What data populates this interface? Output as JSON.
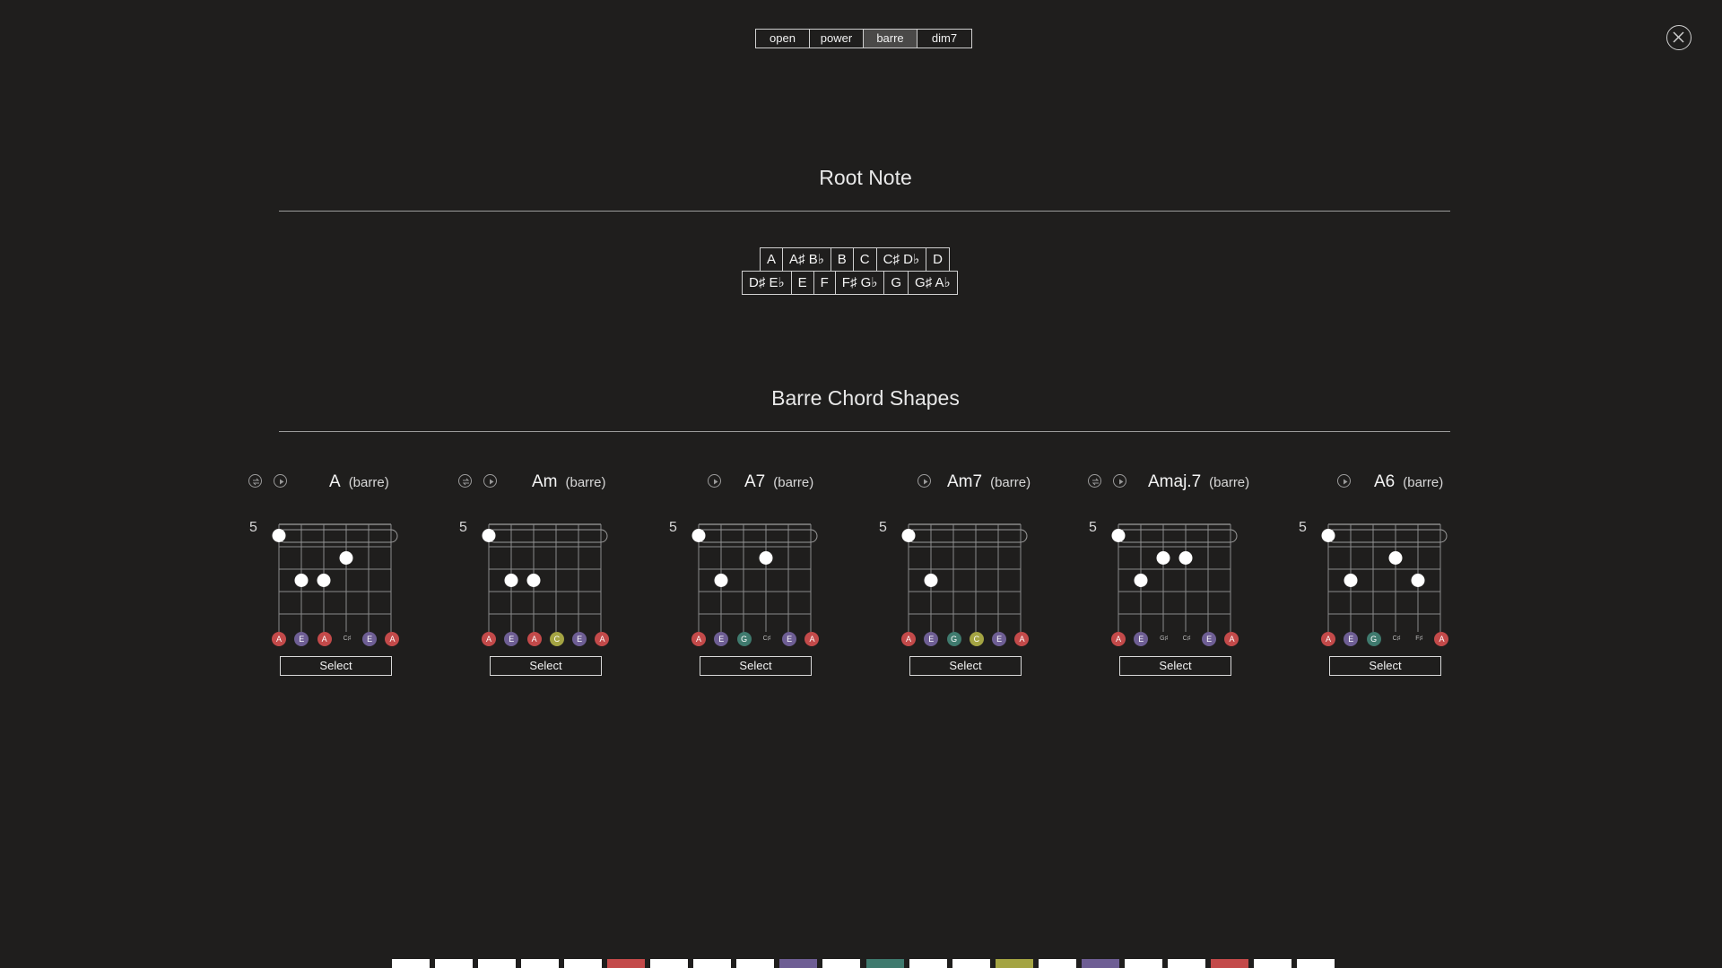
{
  "type_tabs": {
    "items": [
      "open",
      "power",
      "barre",
      "dim7"
    ],
    "selected": "barre"
  },
  "close_icon": "close-icon",
  "root_note": {
    "title": "Root Note",
    "row1": [
      "A",
      "A♯ B♭",
      "B",
      "C",
      "C♯ D♭",
      "D"
    ],
    "row2": [
      "D♯ E♭",
      "E",
      "F",
      "F♯ G♭",
      "G",
      "G♯ A♭"
    ]
  },
  "shapes": {
    "title": "Barre Chord Shapes",
    "select_label": "Select",
    "chords": [
      {
        "name": "A",
        "type": "(barre)",
        "fret": "5",
        "has_swap": true,
        "dots": [
          {
            "string": 1,
            "fret": 1
          },
          {
            "string": 2,
            "fret": 3
          },
          {
            "string": 3,
            "fret": 3
          },
          {
            "string": 4,
            "fret": 2
          }
        ],
        "notes": [
          {
            "label": "A",
            "color": "#c34a4a"
          },
          {
            "label": "E",
            "color": "#6e5e94"
          },
          {
            "label": "A",
            "color": "#c34a4a"
          },
          {
            "label": "C♯",
            "color": ""
          },
          {
            "label": "E",
            "color": "#6e5e94"
          },
          {
            "label": "A",
            "color": "#c34a4a"
          }
        ]
      },
      {
        "name": "Am",
        "type": "(barre)",
        "fret": "5",
        "has_swap": true,
        "dots": [
          {
            "string": 1,
            "fret": 1
          },
          {
            "string": 2,
            "fret": 3
          },
          {
            "string": 3,
            "fret": 3
          }
        ],
        "notes": [
          {
            "label": "A",
            "color": "#c34a4a"
          },
          {
            "label": "E",
            "color": "#6e5e94"
          },
          {
            "label": "A",
            "color": "#c34a4a"
          },
          {
            "label": "C",
            "color": "#a4a443"
          },
          {
            "label": "E",
            "color": "#6e5e94"
          },
          {
            "label": "A",
            "color": "#c34a4a"
          }
        ]
      },
      {
        "name": "A7",
        "type": "(barre)",
        "fret": "5",
        "has_swap": false,
        "dots": [
          {
            "string": 1,
            "fret": 1
          },
          {
            "string": 2,
            "fret": 3
          },
          {
            "string": 4,
            "fret": 2
          }
        ],
        "notes": [
          {
            "label": "A",
            "color": "#c34a4a"
          },
          {
            "label": "E",
            "color": "#6e5e94"
          },
          {
            "label": "G",
            "color": "#3f7a6e"
          },
          {
            "label": "C♯",
            "color": ""
          },
          {
            "label": "E",
            "color": "#6e5e94"
          },
          {
            "label": "A",
            "color": "#c34a4a"
          }
        ]
      },
      {
        "name": "Am7",
        "type": "(barre)",
        "fret": "5",
        "has_swap": false,
        "dots": [
          {
            "string": 1,
            "fret": 1
          },
          {
            "string": 2,
            "fret": 3
          }
        ],
        "notes": [
          {
            "label": "A",
            "color": "#c34a4a"
          },
          {
            "label": "E",
            "color": "#6e5e94"
          },
          {
            "label": "G",
            "color": "#3f7a6e"
          },
          {
            "label": "C",
            "color": "#a4a443"
          },
          {
            "label": "E",
            "color": "#6e5e94"
          },
          {
            "label": "A",
            "color": "#c34a4a"
          }
        ]
      },
      {
        "name": "Amaj.7",
        "type": "(barre)",
        "fret": "5",
        "has_swap": true,
        "dots": [
          {
            "string": 1,
            "fret": 1
          },
          {
            "string": 2,
            "fret": 3
          },
          {
            "string": 3,
            "fret": 2
          },
          {
            "string": 4,
            "fret": 2
          }
        ],
        "notes": [
          {
            "label": "A",
            "color": "#c34a4a"
          },
          {
            "label": "E",
            "color": "#6e5e94"
          },
          {
            "label": "G♯",
            "color": ""
          },
          {
            "label": "C♯",
            "color": ""
          },
          {
            "label": "E",
            "color": "#6e5e94"
          },
          {
            "label": "A",
            "color": "#c34a4a"
          }
        ]
      },
      {
        "name": "A6",
        "type": "(barre)",
        "fret": "5",
        "has_swap": false,
        "dots": [
          {
            "string": 1,
            "fret": 1
          },
          {
            "string": 2,
            "fret": 3
          },
          {
            "string": 4,
            "fret": 2
          },
          {
            "string": 5,
            "fret": 3
          }
        ],
        "notes": [
          {
            "label": "A",
            "color": "#c34a4a"
          },
          {
            "label": "E",
            "color": "#6e5e94"
          },
          {
            "label": "G",
            "color": "#3f7a6e"
          },
          {
            "label": "C♯",
            "color": ""
          },
          {
            "label": "F♯",
            "color": ""
          },
          {
            "label": "A",
            "color": "#c34a4a"
          }
        ]
      }
    ]
  },
  "keyboard": {
    "colors": [
      "#ffffff",
      "#ffffff",
      "#ffffff",
      "#ffffff",
      "#ffffff",
      "#c34a4a",
      "#ffffff",
      "#ffffff",
      "#ffffff",
      "#6e5e94",
      "#ffffff",
      "#3f7a6e",
      "#ffffff",
      "#ffffff",
      "#a4a443",
      "#ffffff",
      "#6e5e94",
      "#ffffff",
      "#ffffff",
      "#c34a4a",
      "#ffffff",
      "#ffffff"
    ]
  }
}
